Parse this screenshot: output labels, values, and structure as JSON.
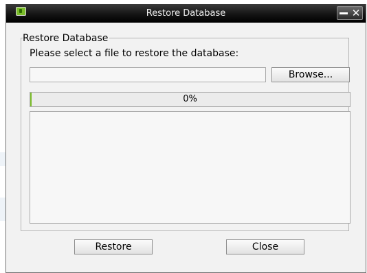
{
  "window": {
    "title": "Restore Database",
    "controls": {
      "minimize_icon": "minimize-icon",
      "close_glyph": "✕"
    }
  },
  "group": {
    "title": "Restore Database",
    "prompt": "Please select a file to restore the database:"
  },
  "file_input": {
    "value": "",
    "placeholder": ""
  },
  "buttons": {
    "browse": "Browse...",
    "restore": "Restore",
    "close": "Close"
  },
  "progress": {
    "value_fraction": 0.0,
    "label": "0%"
  },
  "log": {
    "content": ""
  },
  "colors": {
    "titlebar": "#141414",
    "accent": "#7bbd2a",
    "window_bg": "#f2f2f2"
  }
}
